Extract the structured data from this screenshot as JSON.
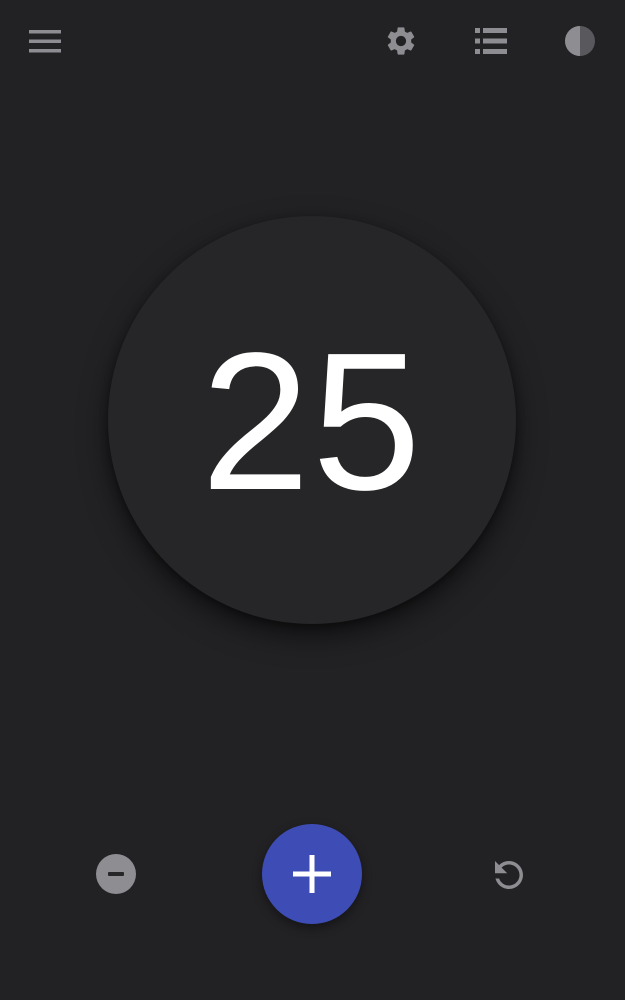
{
  "toolbar": {
    "menu_icon": "hamburger-menu-icon",
    "settings_icon": "gear-icon",
    "list_icon": "list-icon",
    "theme_icon": "half-circle-contrast-icon"
  },
  "counter": {
    "value": "25"
  },
  "controls": {
    "decrement_icon": "minus-circle-icon",
    "increment_icon": "plus-icon",
    "reset_icon": "refresh-icon"
  },
  "colors": {
    "background": "#222124",
    "circle": "#262528",
    "accent": "#3e4db6",
    "icon": "#8e8d92",
    "text": "#ffffff"
  }
}
